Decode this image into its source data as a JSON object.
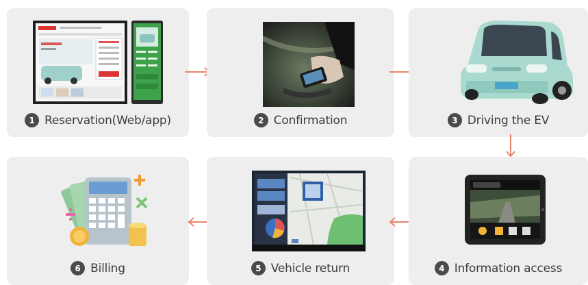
{
  "steps": [
    {
      "num": "1",
      "label": "Reservation(Web/app)"
    },
    {
      "num": "2",
      "label": "Confirmation"
    },
    {
      "num": "3",
      "label": "Driving the EV"
    },
    {
      "num": "4",
      "label": "Information access"
    },
    {
      "num": "5",
      "label": "Vehicle return"
    },
    {
      "num": "6",
      "label": "Billing"
    }
  ],
  "colors": {
    "card_bg": "#eeeeef",
    "arrow": "#e8836b",
    "badge": "#4a4a4a",
    "car_body": "#a9d9cf",
    "app_green": "#3ea24b"
  }
}
